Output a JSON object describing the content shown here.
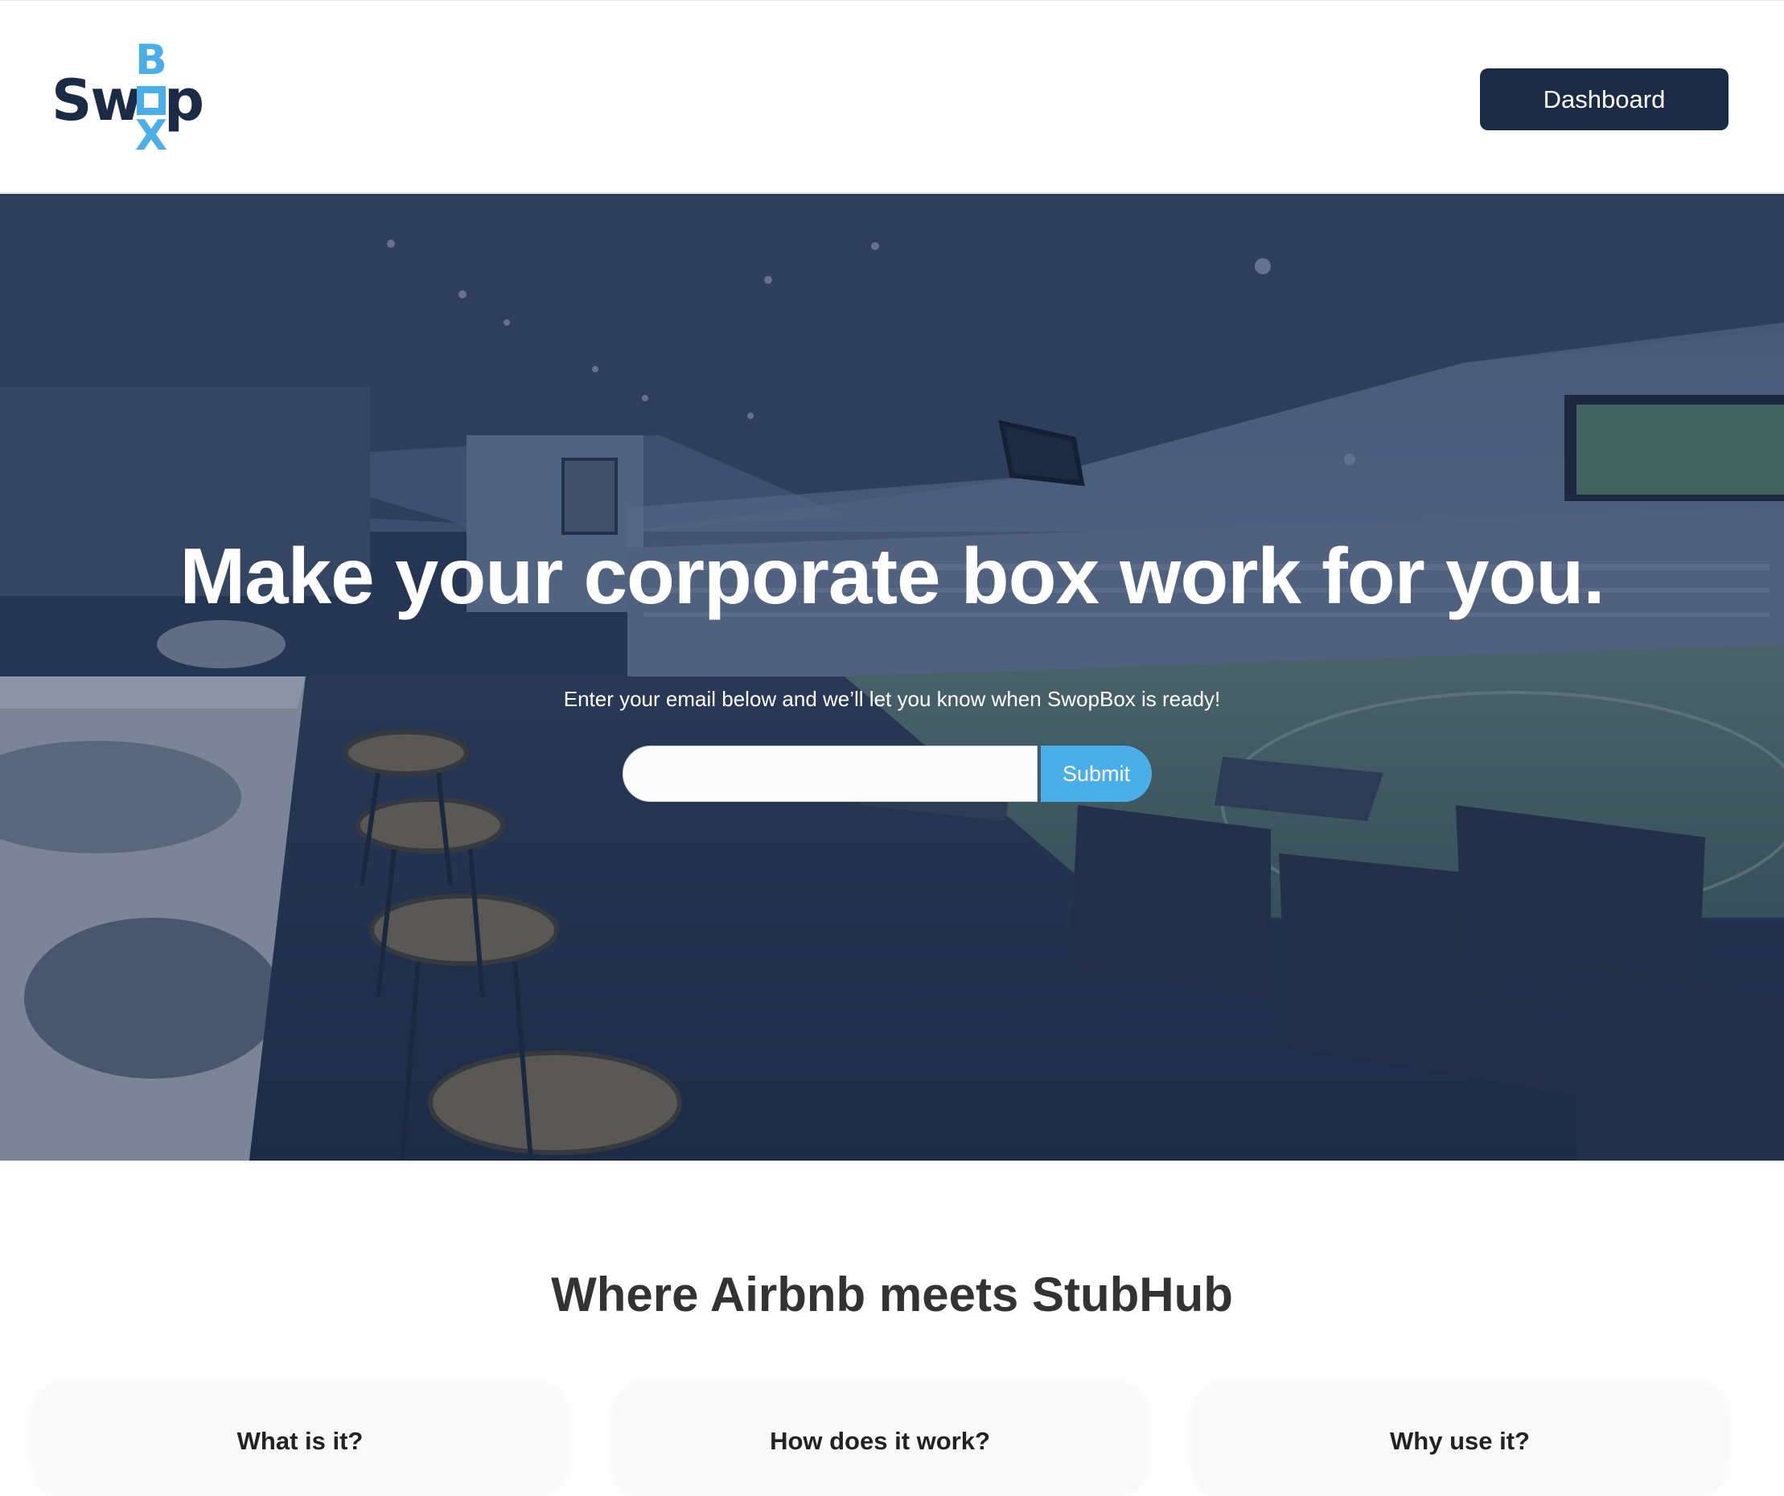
{
  "header": {
    "logo": {
      "text_left": "Sw",
      "text_right": "p",
      "box_top": "B",
      "box_bottom": "X",
      "colors": {
        "dark": "#1b2b45",
        "accent": "#4aaee8"
      }
    },
    "dashboard_label": "Dashboard"
  },
  "hero": {
    "title": "Make your corporate box work for you.",
    "subtitle": "Enter your email below and we’ll let you know when SwopBox is ready!",
    "email_input": {
      "value": "",
      "placeholder": ""
    },
    "submit_label": "Submit",
    "background_image": "stadium-corporate-box-interior"
  },
  "features": {
    "title": "Where Airbnb meets StubHub",
    "cards": [
      {
        "title": "What is it?"
      },
      {
        "title": "How does it work?"
      },
      {
        "title": "Why use it?"
      }
    ]
  },
  "colors": {
    "brand_dark": "#1b2b45",
    "brand_accent": "#4aaee8",
    "text_dark": "#333333"
  }
}
